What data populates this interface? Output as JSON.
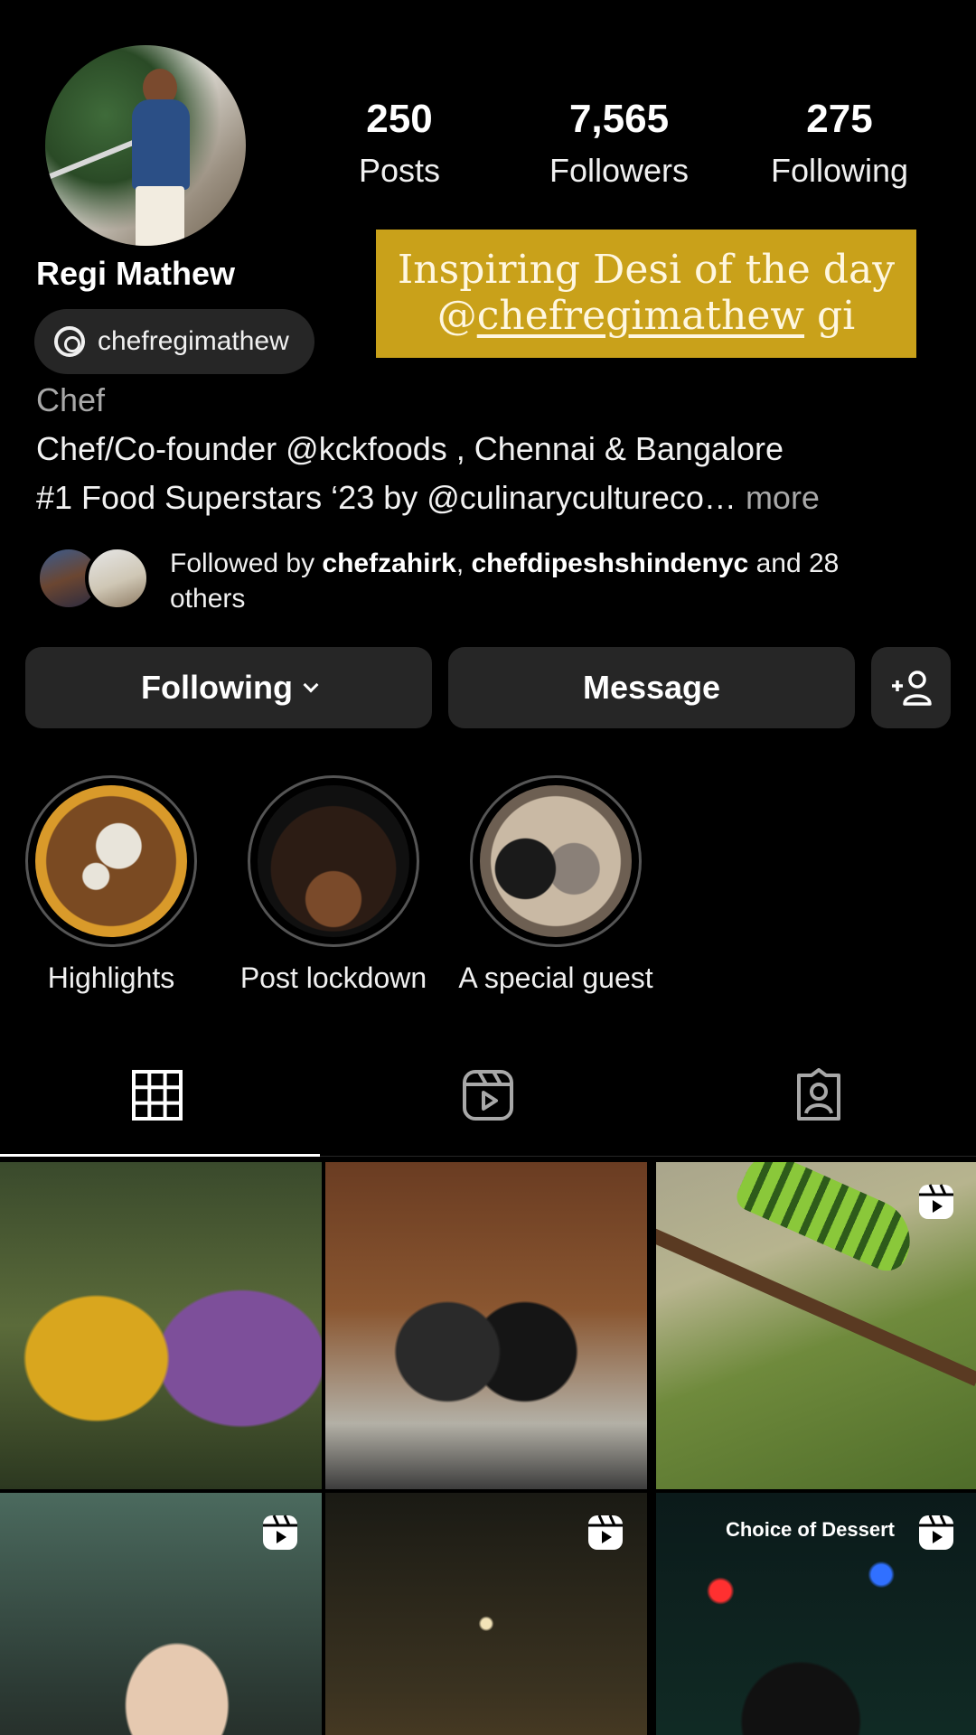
{
  "profile": {
    "name": "Regi Mathew",
    "threads_handle": "chefregimathew",
    "category": "Chef",
    "bio_line1": "Chef/Co-founder @kckfoods , Chennai & Bangalore",
    "bio_line2": "#1 Food Superstars ‘23 by @culinarycultureco…",
    "bio_more": "more"
  },
  "stats": {
    "posts": {
      "value": "250",
      "label": "Posts"
    },
    "followers": {
      "value": "7,565",
      "label": "Followers"
    },
    "following": {
      "value": "275",
      "label": "Following"
    }
  },
  "banner": {
    "line1": "Inspiring Desi of the day",
    "line2_prefix": "@",
    "line2_handle": "chefregimathew",
    "line2_suffix": " gi"
  },
  "followed_by": {
    "prefix": "Followed by ",
    "user1": "chefzahirk",
    "sep": ", ",
    "user2": "chefdipeshshindenyc",
    "suffix": " and 28 others"
  },
  "actions": {
    "following_label": "Following",
    "message_label": "Message"
  },
  "highlights": [
    {
      "label": "Highlights"
    },
    {
      "label": "Post lockdown"
    },
    {
      "label": "A special guest"
    }
  ],
  "posts": [
    {
      "caption": ""
    },
    {
      "caption": ""
    },
    {
      "caption": ""
    },
    {
      "caption": ""
    },
    {
      "caption": ""
    },
    {
      "caption": "Choice of Dessert"
    }
  ],
  "icons": {
    "threads": "threads-icon",
    "add_person": "add-person-icon",
    "grid": "grid-icon",
    "reels": "reels-icon",
    "tagged": "tagged-icon",
    "reel_badge": "reel-badge-icon"
  },
  "colors": {
    "background": "#000000",
    "button": "#262626",
    "banner": "#c9a11a",
    "muted_text": "#a8a8a8"
  }
}
